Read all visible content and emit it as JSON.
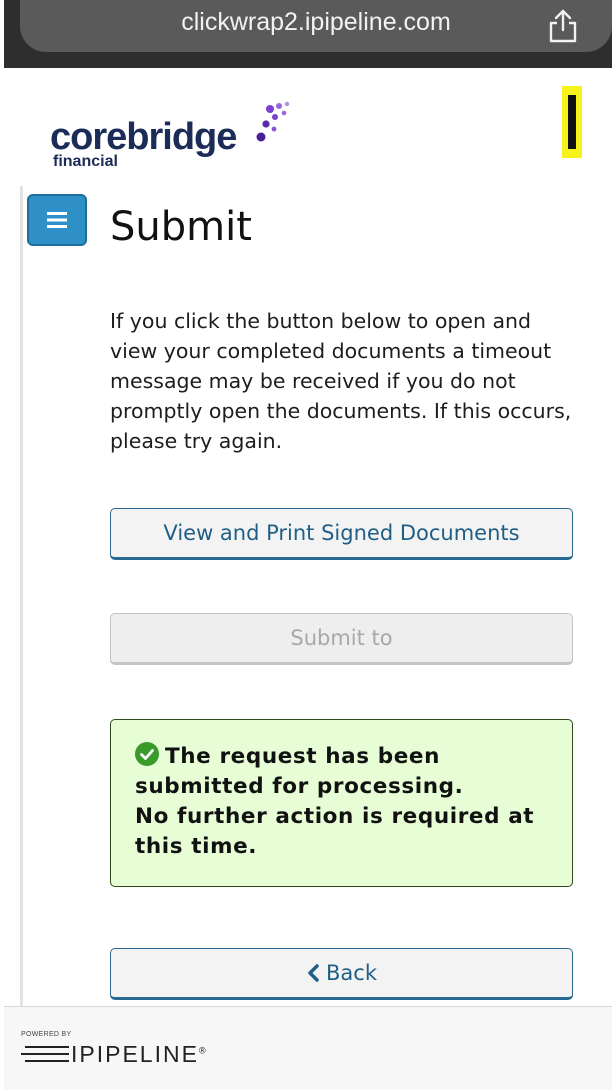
{
  "browser": {
    "url": "clickwrap2.ipipeline.com",
    "share_icon": "share-icon"
  },
  "header": {
    "logo_main": "corebridge",
    "logo_sub": "financial"
  },
  "page": {
    "title": "Submit",
    "info_text": "If you click the button below to open and view your completed documents a timeout message may be received if you do not promptly open the documents. If this occurs, please try again.",
    "menu_icon": "hamburger-menu-icon"
  },
  "buttons": {
    "view_print": "View and Print Signed Documents",
    "submit_to": "Submit to",
    "back": "Back"
  },
  "success": {
    "line1": "The request has been submitted for processing.",
    "line2": "No further action is required at this time.",
    "icon": "check-circle-icon"
  },
  "footer": {
    "powered_by": "POWERED BY",
    "brand": "IPIPELINE",
    "trademark": "®"
  },
  "colors": {
    "primary_blue": "#1f5f86",
    "menu_blue": "#2f8fc7",
    "success_bg": "#e6fdd5",
    "success_icon": "#3a9a2a",
    "brand_navy": "#1c2c58",
    "brand_purple": "#7b3fd1"
  }
}
